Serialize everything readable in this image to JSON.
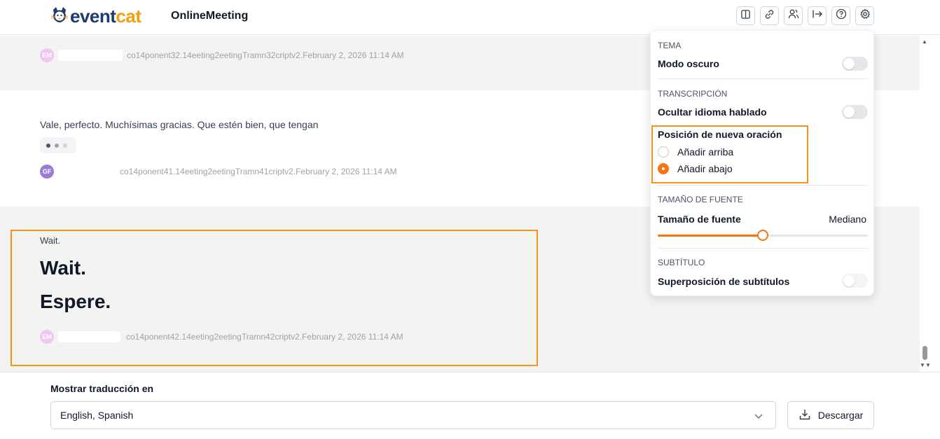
{
  "header": {
    "logo": {
      "part1": "event",
      "part2": "cat"
    },
    "title": "OnlineMeeting",
    "buttons": [
      "sidebar-panel-icon",
      "link-icon",
      "users-icon",
      "exit-icon",
      "help-icon",
      "gear-icon"
    ]
  },
  "transcript": {
    "entries": [
      {
        "initials": "EM",
        "meta": "co14ponent32.14eeting2eetingTramn32criptv2.February 2, 2026 11:14 AM"
      },
      {
        "original": "Vale, perfecto. Muchísimas gracias. Que estén bien, que tengan",
        "initials": "GF",
        "meta": "co14ponent41.14eeting2eetingTramn41criptv2.February 2, 2026 11:14 AM"
      },
      {
        "original": "Wait.",
        "translation_1": "Wait.",
        "translation_2": "Espere.",
        "initials": "EM",
        "meta": "co14ponent42.14eeting2eetingTramn42criptv2.February 2, 2026 11:14 AM"
      }
    ]
  },
  "settings": {
    "theme": {
      "title": "TEMA",
      "dark_mode_label": "Modo oscuro",
      "dark_mode_on": false
    },
    "transcription": {
      "title": "TRANSCRIPCIÓN",
      "hide_language_label": "Ocultar idioma hablado",
      "hide_language_on": false,
      "new_sentence_label": "Posición de nueva oración",
      "options": [
        {
          "label": "Añadir arriba",
          "selected": false
        },
        {
          "label": "Añadir abajo",
          "selected": true
        }
      ]
    },
    "font_size": {
      "title": "TAMAÑO DE FUENTE",
      "label": "Tamaño de fuente",
      "value_label": "Mediano",
      "level": 0.5
    },
    "subtitle": {
      "title": "SUBTÍTULO",
      "overlay_label": "Superposición de subtítulos",
      "overlay_on": false
    }
  },
  "footer": {
    "label": "Mostrar traducción en",
    "selected_languages": "English, Spanish",
    "download_label": "Descargar"
  },
  "colors": {
    "accent": "#f97316",
    "highlight": "#f59321",
    "brand_dark": "#1e3a6e",
    "brand_orange": "#f59e0b"
  }
}
